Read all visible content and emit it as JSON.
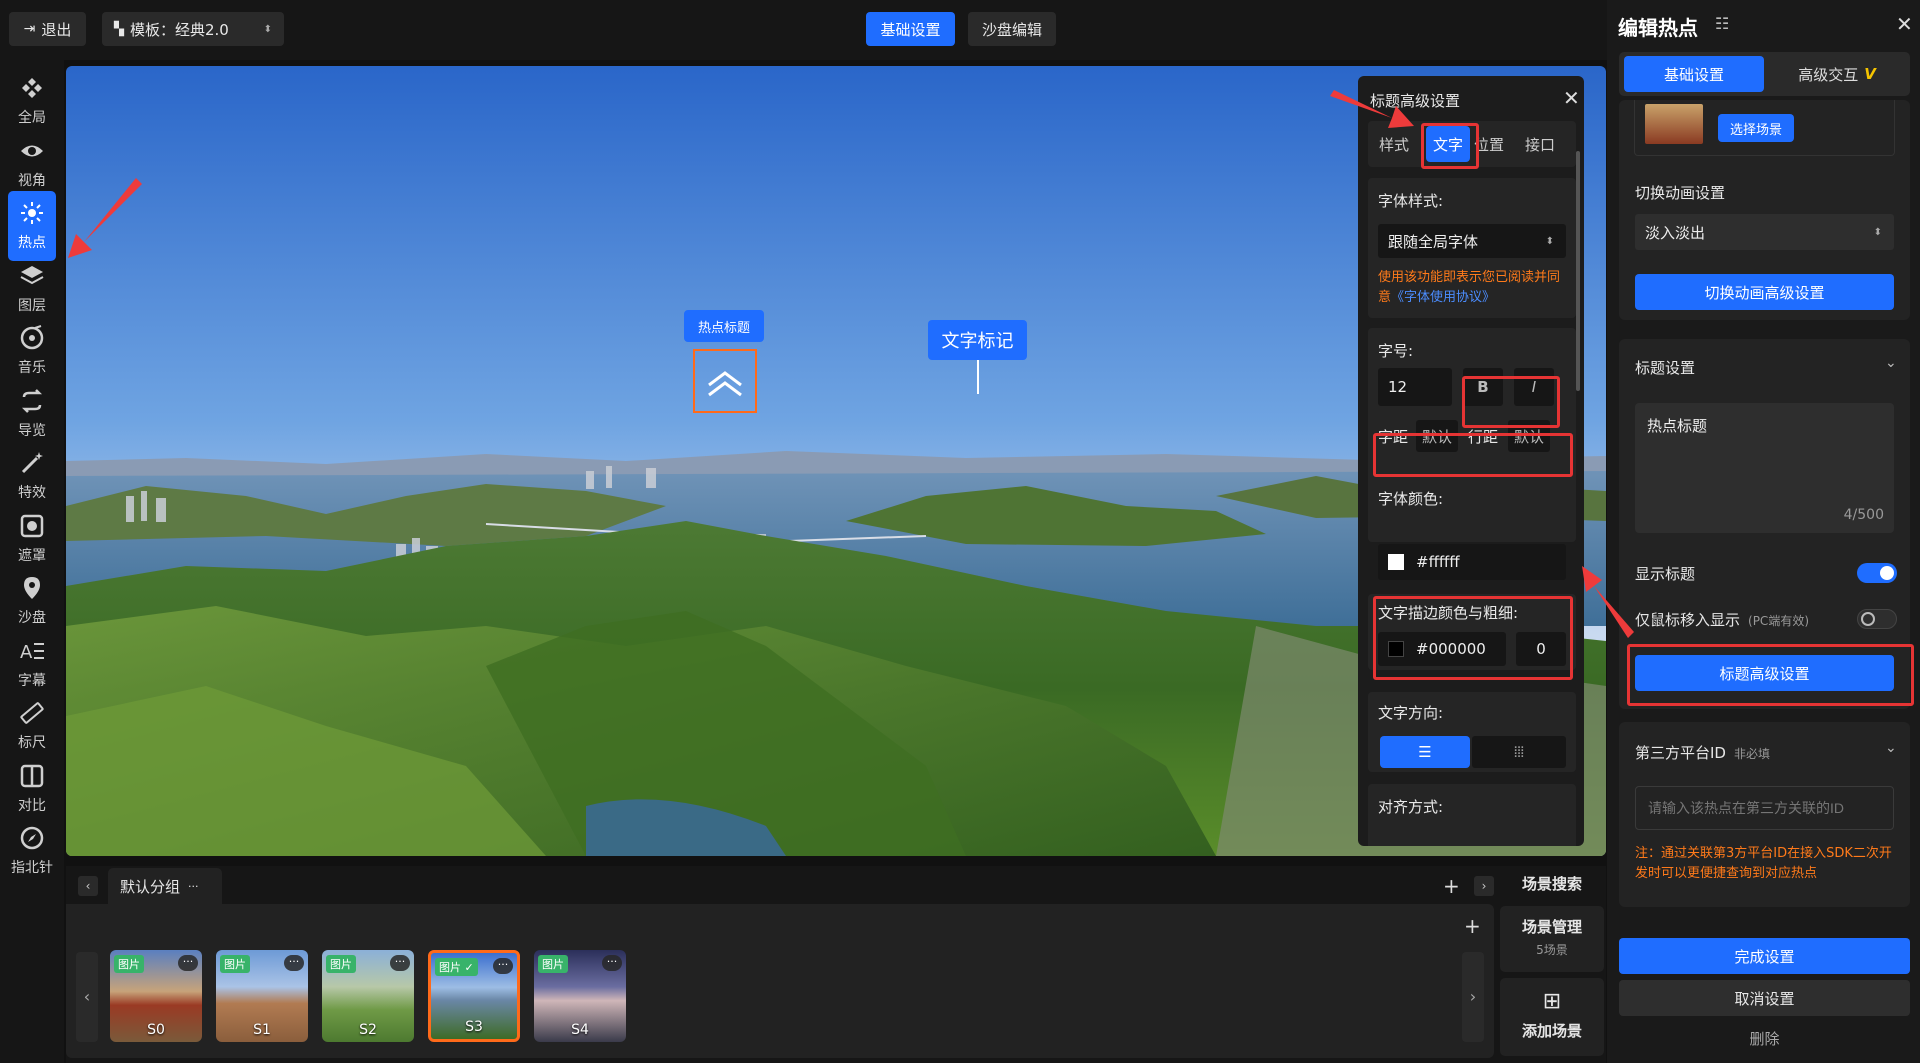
{
  "topbar": {
    "exit_label": "退出",
    "template_label": "模板：经典2.0",
    "tab_basic": "基础设置",
    "tab_sandbox": "沙盘编辑"
  },
  "sidebar": {
    "items": [
      {
        "label": "全局",
        "icon": "global-icon"
      },
      {
        "label": "视角",
        "icon": "eye-icon"
      },
      {
        "label": "热点",
        "icon": "hotspot-icon",
        "active": true
      },
      {
        "label": "图层",
        "icon": "layers-icon"
      },
      {
        "label": "音乐",
        "icon": "music-icon"
      },
      {
        "label": "导览",
        "icon": "tour-icon"
      },
      {
        "label": "特效",
        "icon": "magic-wand-icon"
      },
      {
        "label": "遮罩",
        "icon": "mask-icon"
      },
      {
        "label": "沙盘",
        "icon": "map-pin-icon"
      },
      {
        "label": "字幕",
        "icon": "subtitle-icon"
      },
      {
        "label": "标尺",
        "icon": "ruler-icon"
      },
      {
        "label": "对比",
        "icon": "compare-icon"
      },
      {
        "label": "指北针",
        "icon": "compass-icon"
      }
    ]
  },
  "viewport": {
    "hotspot_title": "热点标题",
    "text_marker": "文字标记"
  },
  "title_panel": {
    "header": "标题高级设置",
    "tabs": [
      "样式",
      "文字",
      "位置",
      "接口"
    ],
    "active_tab": "文字",
    "font_style_label": "字体样式:",
    "font_select": "跟随全局字体",
    "notice_prefix": "使用该功能即表示您已阅读并同意",
    "notice_link": "《字体使用协议》",
    "font_size_label": "字号:",
    "font_size_value": "12",
    "bold": "B",
    "italic": "I",
    "letter_spacing_label": "字距",
    "letter_spacing_value": "默认",
    "line_height_label": "行距",
    "line_height_value": "默认",
    "color_label": "字体颜色:",
    "color_value": "#ffffff",
    "stroke_label": "文字描边颜色与粗细:",
    "stroke_color": "#000000",
    "stroke_width": "0",
    "direction_label": "文字方向:",
    "align_label": "对齐方式:"
  },
  "bottom": {
    "group_name": "默认分组",
    "group_more": "···",
    "scene_search": "场景搜索",
    "scene_manage": "场景管理",
    "scene_count": "5场景",
    "add_scene": "添加场景",
    "scenes": [
      {
        "name": "S0",
        "tag": "图片"
      },
      {
        "name": "S1",
        "tag": "图片"
      },
      {
        "name": "S2",
        "tag": "图片"
      },
      {
        "name": "S3",
        "tag": "图片",
        "selected": true
      },
      {
        "name": "S4",
        "tag": "图片"
      }
    ]
  },
  "right_panel": {
    "title": "编辑热点",
    "tab_basic": "基础设置",
    "tab_advanced": "高级交互",
    "vip_mark": "V",
    "choose_scene": "选择场景",
    "transition_label": "切换动画设置",
    "transition_value": "淡入淡出",
    "transition_adv_button": "切换动画高级设置",
    "title_settings_label": "标题设置",
    "title_text": "热点标题",
    "char_count": "4/500",
    "show_title_label": "显示标题",
    "hover_only_label": "仅鼠标移入显示",
    "hover_only_note": "(PC端有效)",
    "title_adv_button": "标题高级设置",
    "third_party_label": "第三方平台ID",
    "third_party_optional": "非必填",
    "third_party_placeholder": "请输入该热点在第三方关联的ID",
    "third_party_note": "注：通过关联第3方平台ID在接入SDK二次开发时可以更便捷查询到对应热点",
    "done_button": "完成设置",
    "cancel_button": "取消设置",
    "delete_button": "删除"
  },
  "colors": {
    "accent": "#1f6dff",
    "highlight_red": "#e63434",
    "notice_orange": "#ff7a1a"
  }
}
